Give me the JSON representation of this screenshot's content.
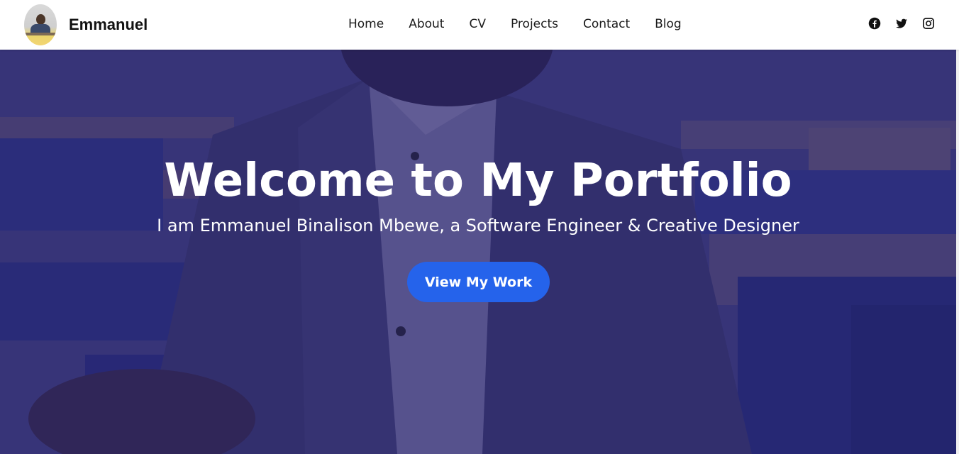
{
  "brand": {
    "name": "Emmanuel"
  },
  "nav": {
    "items": [
      "Home",
      "About",
      "CV",
      "Projects",
      "Contact",
      "Blog"
    ]
  },
  "socials": [
    {
      "icon": "facebook-icon"
    },
    {
      "icon": "twitter-icon"
    },
    {
      "icon": "instagram-icon"
    }
  ],
  "hero": {
    "title": "Welcome to My Portfolio",
    "subtitle": "I am Emmanuel Binalison Mbewe, a Software Engineer & Creative Designer",
    "cta_label": "View My Work"
  },
  "colors": {
    "accent": "#2563eb",
    "overlay": "#28236e",
    "header_bg": "#ffffff"
  }
}
